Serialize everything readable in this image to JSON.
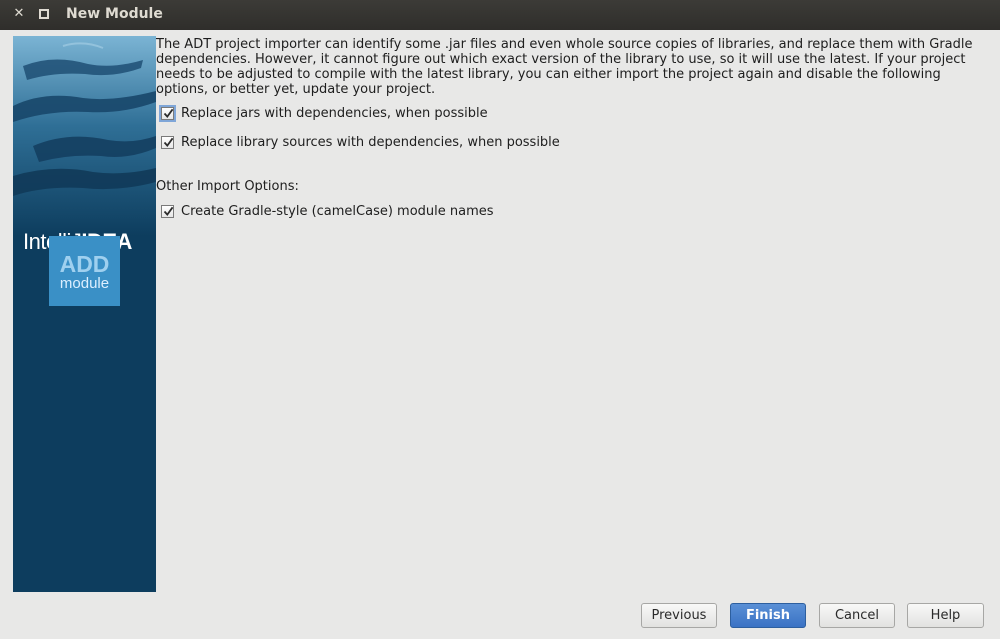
{
  "window": {
    "title": "New Module"
  },
  "sidebar": {
    "brand_light": "IntelliJ",
    "brand_bold": "IDEA",
    "badge_line1": "ADD",
    "badge_line2": "module"
  },
  "main": {
    "description": "The ADT project importer can identify some .jar files and even whole source copies of libraries, and replace them with Gradle dependencies. However, it cannot figure out which exact version of the library to use, so it will use the latest. If your project needs to be adjusted to compile with the latest library, you can either import the project again and disable the following options, or better yet, update your project.",
    "options": [
      {
        "label": "Replace jars with dependencies, when possible",
        "checked": true
      },
      {
        "label": "Replace library sources with dependencies, when possible",
        "checked": true
      }
    ],
    "other_label": "Other Import Options:",
    "other_options": [
      {
        "label": "Create Gradle-style (camelCase) module names",
        "checked": true
      }
    ]
  },
  "buttons": {
    "previous": "Previous",
    "finish": "Finish",
    "cancel": "Cancel",
    "help": "Help"
  }
}
